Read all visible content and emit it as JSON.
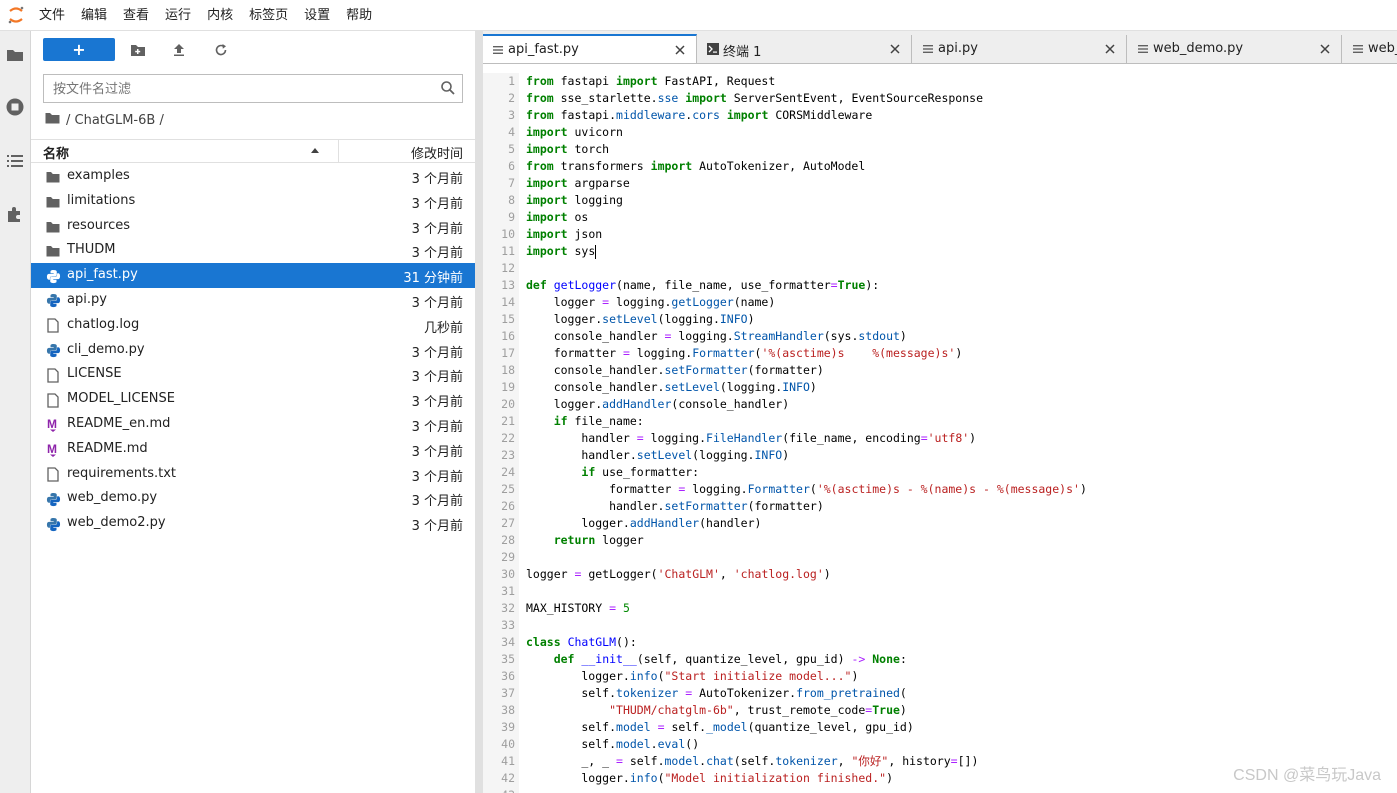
{
  "menu": [
    "文件",
    "编辑",
    "查看",
    "运行",
    "内核",
    "标签页",
    "设置",
    "帮助"
  ],
  "filebrowser": {
    "new_label": "+",
    "search_placeholder": "按文件名过滤",
    "breadcrumb": "/ ChatGLM-6B /",
    "header_name": "名称",
    "header_modified": "修改时间",
    "files": [
      {
        "name": "examples",
        "type": "folder",
        "modified": "3 个月前"
      },
      {
        "name": "limitations",
        "type": "folder",
        "modified": "3 个月前"
      },
      {
        "name": "resources",
        "type": "folder",
        "modified": "3 个月前"
      },
      {
        "name": "THUDM",
        "type": "folder",
        "modified": "3 个月前"
      },
      {
        "name": "api_fast.py",
        "type": "python",
        "modified": "31 分钟前",
        "selected": true
      },
      {
        "name": "api.py",
        "type": "python",
        "modified": "3 个月前"
      },
      {
        "name": "chatlog.log",
        "type": "file",
        "modified": "几秒前"
      },
      {
        "name": "cli_demo.py",
        "type": "python",
        "modified": "3 个月前"
      },
      {
        "name": "LICENSE",
        "type": "file",
        "modified": "3 个月前"
      },
      {
        "name": "MODEL_LICENSE",
        "type": "file",
        "modified": "3 个月前"
      },
      {
        "name": "README_en.md",
        "type": "markdown",
        "modified": "3 个月前"
      },
      {
        "name": "README.md",
        "type": "markdown",
        "modified": "3 个月前"
      },
      {
        "name": "requirements.txt",
        "type": "file",
        "modified": "3 个月前"
      },
      {
        "name": "web_demo.py",
        "type": "python",
        "modified": "3 个月前"
      },
      {
        "name": "web_demo2.py",
        "type": "python",
        "modified": "3 个月前"
      }
    ]
  },
  "tabs": [
    {
      "label": "api_fast.py",
      "icon": "file-icon",
      "active": true
    },
    {
      "label": "终端 1",
      "icon": "terminal-icon",
      "active": false
    },
    {
      "label": "api.py",
      "icon": "file-icon",
      "active": false
    },
    {
      "label": "web_demo.py",
      "icon": "file-icon",
      "active": false
    },
    {
      "label": "web_",
      "icon": "file-icon",
      "active": false
    }
  ],
  "editor": {
    "lines": [
      "from fastapi import FastAPI, Request",
      "from sse_starlette.sse import ServerSentEvent, EventSourceResponse",
      "from fastapi.middleware.cors import CORSMiddleware",
      "import uvicorn",
      "import torch",
      "from transformers import AutoTokenizer, AutoModel",
      "import argparse",
      "import logging",
      "import os",
      "import json",
      "import sys",
      "",
      "def getLogger(name, file_name, use_formatter=True):",
      "    logger = logging.getLogger(name)",
      "    logger.setLevel(logging.INFO)",
      "    console_handler = logging.StreamHandler(sys.stdout)",
      "    formatter = logging.Formatter('%(asctime)s    %(message)s')",
      "    console_handler.setFormatter(formatter)",
      "    console_handler.setLevel(logging.INFO)",
      "    logger.addHandler(console_handler)",
      "    if file_name:",
      "        handler = logging.FileHandler(file_name, encoding='utf8')",
      "        handler.setLevel(logging.INFO)",
      "        if use_formatter:",
      "            formatter = logging.Formatter('%(asctime)s - %(name)s - %(message)s')",
      "            handler.setFormatter(formatter)",
      "        logger.addHandler(handler)",
      "    return logger",
      "",
      "logger = getLogger('ChatGLM', 'chatlog.log')",
      "",
      "MAX_HISTORY = 5",
      "",
      "class ChatGLM():",
      "    def __init__(self, quantize_level, gpu_id) -> None:",
      "        logger.info(\"Start initialize model...\")",
      "        self.tokenizer = AutoTokenizer.from_pretrained(",
      "            \"THUDM/chatglm-6b\", trust_remote_code=True)",
      "        self.model = self._model(quantize_level, gpu_id)",
      "        self.model.eval()",
      "        _, _ = self.model.chat(self.tokenizer, \"你好\", history=[])",
      "        logger.info(\"Model initialization finished.\")",
      ""
    ]
  },
  "watermark": "CSDN @菜鸟玩Java",
  "colors": {
    "accent": "#1976d2",
    "keyword": "#008000",
    "string": "#ba2121",
    "function": "#0000ff"
  }
}
